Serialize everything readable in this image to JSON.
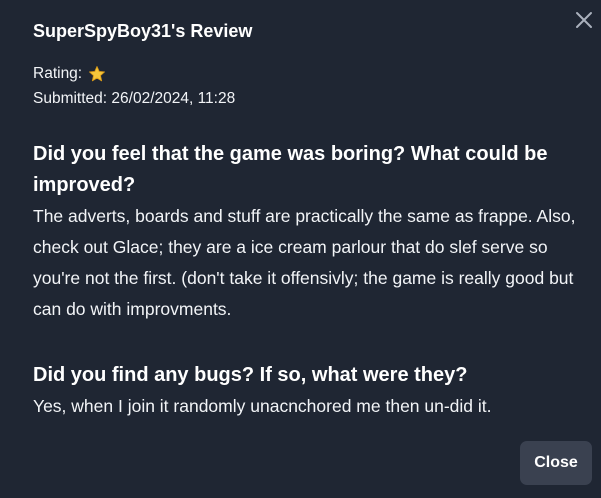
{
  "review": {
    "title": "SuperSpyBoy31's Review",
    "rating_label": "Rating:",
    "rating_icon": "star-icon",
    "rating_value": 1,
    "submitted": "Submitted: 26/02/2024, 11:28"
  },
  "questions": [
    {
      "question": "Did you feel that the game was boring? What could be improved?",
      "answer": "The adverts, boards and stuff are practically the same as frappe. Also, check out Glace; they are a ice cream parlour that do slef serve so you're not the first. (don't take it offensivly; the game is really good but can do with improvments."
    },
    {
      "question": "Did you find any bugs? If so, what were they?",
      "answer": "Yes, when I join it randomly unacnchored me then un-did it."
    }
  ],
  "buttons": {
    "close_label": "Close",
    "dismiss_icon": "close-icon"
  },
  "colors": {
    "background": "#1f2633",
    "button": "#3a4150",
    "star": "#f5c63b"
  }
}
